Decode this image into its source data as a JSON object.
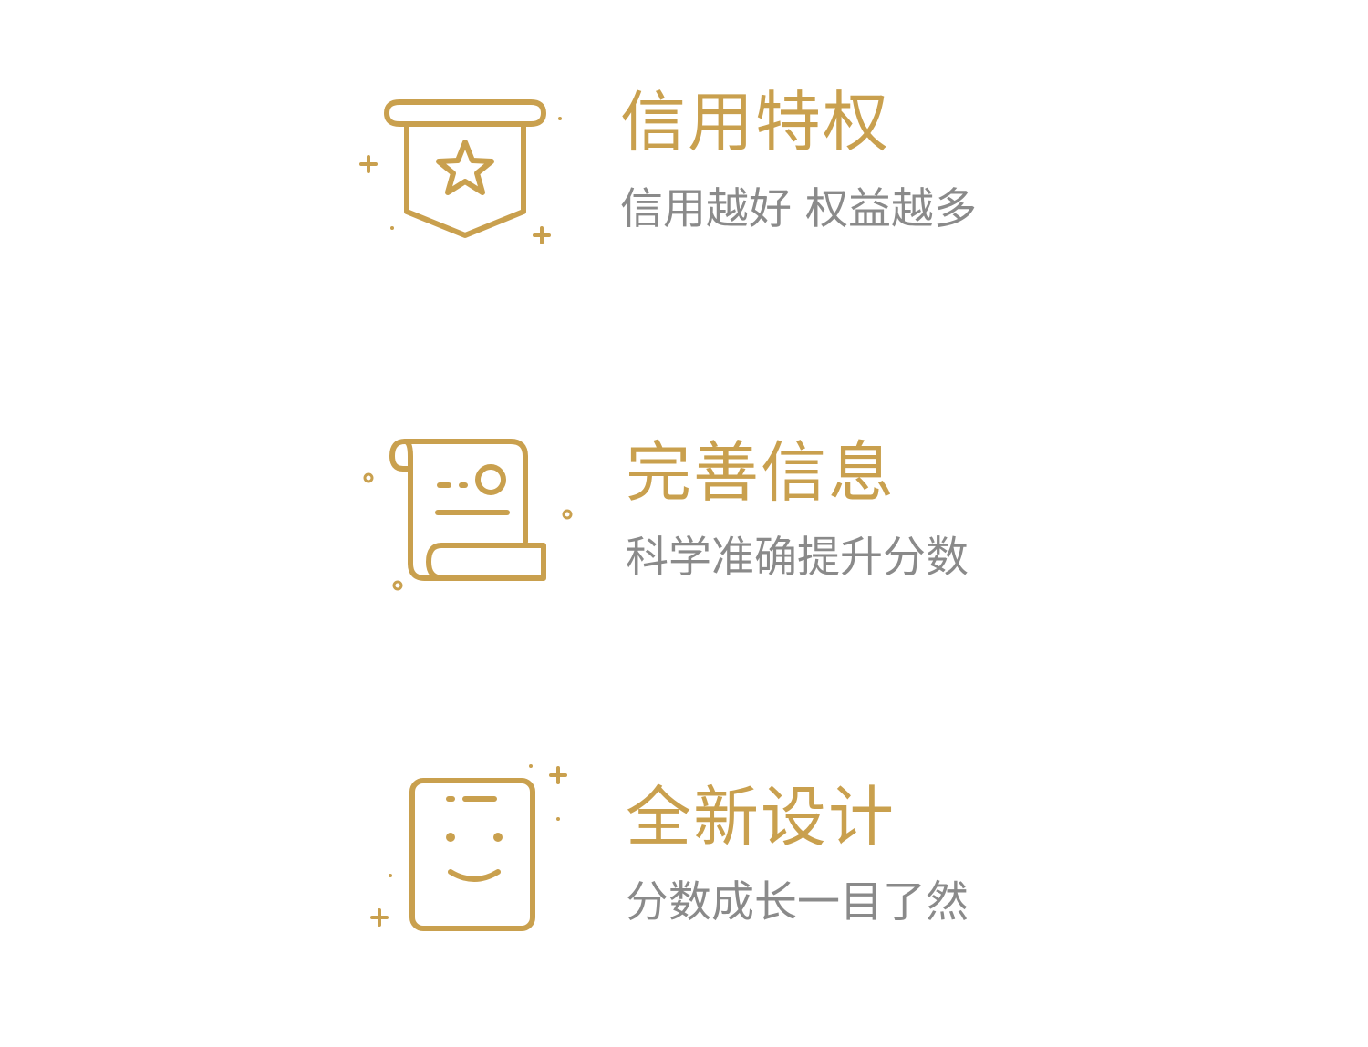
{
  "theme": {
    "accent": "#C9A04E",
    "subtitle_color": "#8A8A8A"
  },
  "features": [
    {
      "icon": "banner-star-icon",
      "title": "信用特权",
      "subtitle": "信用越好 权益越多"
    },
    {
      "icon": "scroll-document-icon",
      "title": "完善信息",
      "subtitle": "科学准确提升分数"
    },
    {
      "icon": "smiley-card-icon",
      "title": "全新设计",
      "subtitle": "分数成长一目了然"
    }
  ]
}
